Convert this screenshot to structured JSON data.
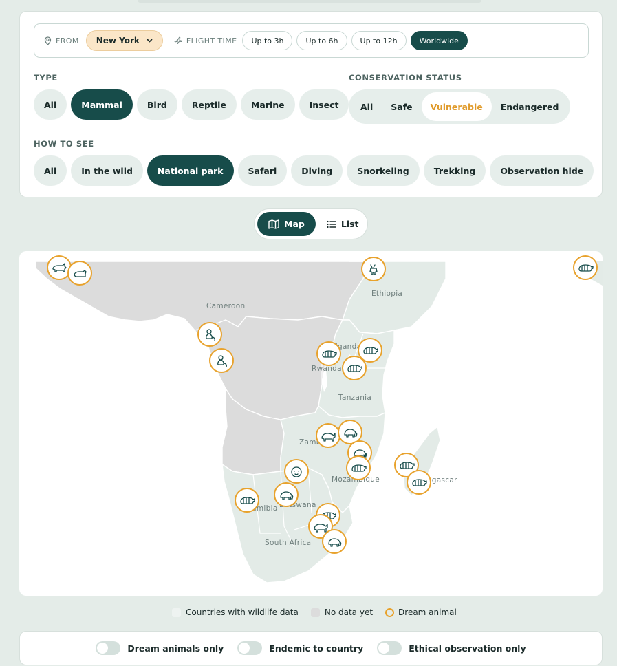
{
  "search": {
    "from_label": "FROM",
    "from_value": "New York",
    "flight_time_label": "FLIGHT TIME",
    "flight_options": [
      "Up to 3h",
      "Up to 6h",
      "Up to 12h",
      "Worldwide"
    ],
    "flight_selected": "Worldwide"
  },
  "type": {
    "title": "TYPE",
    "options": [
      "All",
      "Mammal",
      "Bird",
      "Reptile",
      "Marine",
      "Insect"
    ],
    "selected": "Mammal"
  },
  "conservation": {
    "title": "CONSERVATION STATUS",
    "options": [
      "All",
      "Safe",
      "Vulnerable",
      "Endangered"
    ],
    "selected": "Vulnerable"
  },
  "how_to_see": {
    "title": "HOW TO SEE",
    "options": [
      "All",
      "In the wild",
      "National park",
      "Safari",
      "Diving",
      "Snorkeling",
      "Trekking",
      "Observation hide"
    ],
    "selected": "National park"
  },
  "view_toggle": {
    "map_label": "Map",
    "list_label": "List",
    "selected": "Map"
  },
  "map": {
    "place_labels": [
      "Cameroon",
      "Ethiopia",
      "Uganda",
      "Rwanda",
      "Tanzania",
      "Zambia",
      "Mozambique",
      "Madagascar",
      "Namibia",
      "Botswana",
      "South Africa"
    ],
    "colors": {
      "data_country": "#e3ebe7",
      "no_data_country": "#dcdcdc",
      "border": "#ffffff",
      "marker_ring": "#e8a22c",
      "icon": "#174c4a"
    },
    "marker_icons": [
      "dog-icon",
      "cat-icon",
      "antelope-icon",
      "monkey-icon",
      "monkey-icon",
      "tiger-icon",
      "tiger-icon",
      "tiger-icon",
      "rhino-icon",
      "elephant-icon",
      "elephant-icon",
      "lion-icon",
      "tiger-icon",
      "elephant-icon",
      "tiger-icon",
      "rhino-icon",
      "elephant-icon",
      "tiger-icon",
      "tiger-icon",
      "tiger-icon",
      "tiger-icon"
    ]
  },
  "legend": {
    "with_data": "Countries with wildlife data",
    "no_data": "No data yet",
    "dream": "Dream animal"
  },
  "toggles": [
    {
      "label": "Dream animals only",
      "on": false
    },
    {
      "label": "Endemic to country",
      "on": false
    },
    {
      "label": "Ethical observation only",
      "on": false
    }
  ]
}
